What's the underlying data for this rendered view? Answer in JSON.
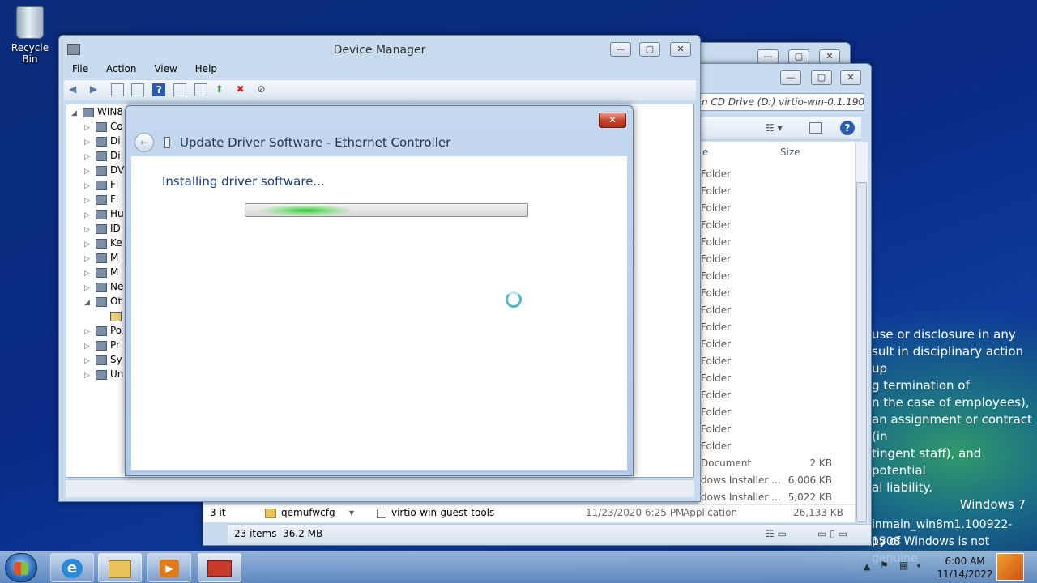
{
  "desktop": {
    "recycle_bin": "Recycle Bin",
    "watermark": [
      "use or disclosure in any",
      "sult in disciplinary action up",
      "g termination of",
      "n the case of employees),",
      "an assignment or contract (in",
      "tingent staff), and potential",
      "al liability."
    ],
    "os_name": "Windows 7",
    "build": "inmain_win8m1.100922-1508",
    "genuine": "py of Windows is not genuine"
  },
  "device_manager": {
    "title": "Device Manager",
    "menu": [
      "File",
      "Action",
      "View",
      "Help"
    ],
    "tree_root": "WIN8",
    "tree_items": [
      "Co",
      "Di",
      "Di",
      "DV",
      "Fl",
      "Fl",
      "Hu",
      "ID",
      "Ke",
      "M",
      "M",
      "Ne",
      "Ot",
      "",
      "Po",
      "Pr",
      "Sy",
      "Un"
    ]
  },
  "dialog": {
    "title": "Update Driver Software - Ethernet Controller",
    "status": "Installing driver software...",
    "progress": "indeterminate"
  },
  "explorer": {
    "address": "n CD Drive (D:) virtio-win-0.1.190",
    "col_name": "e",
    "col_size": "Size",
    "rows": [
      {
        "type": "Folder",
        "size": ""
      },
      {
        "type": "Folder",
        "size": ""
      },
      {
        "type": "Folder",
        "size": ""
      },
      {
        "type": "Folder",
        "size": ""
      },
      {
        "type": "Folder",
        "size": ""
      },
      {
        "type": "Folder",
        "size": ""
      },
      {
        "type": "Folder",
        "size": ""
      },
      {
        "type": "Folder",
        "size": ""
      },
      {
        "type": "Folder",
        "size": ""
      },
      {
        "type": "Folder",
        "size": ""
      },
      {
        "type": "Folder",
        "size": ""
      },
      {
        "type": "Folder",
        "size": ""
      },
      {
        "type": "Folder",
        "size": ""
      },
      {
        "type": "Folder",
        "size": ""
      },
      {
        "type": "Folder",
        "size": ""
      },
      {
        "type": "Folder",
        "size": ""
      },
      {
        "type": "Folder",
        "size": ""
      },
      {
        "type": "Document",
        "size": "2 KB"
      },
      {
        "type": "dows Installer ...",
        "size": "6,006 KB"
      },
      {
        "type": "dows Installer ...",
        "size": "5,022 KB"
      }
    ],
    "bottom_left": "qemufwcfg",
    "bottom_left_prefix": "3 it",
    "last_row": {
      "name": "virtio-win-guest-tools",
      "date": "11/23/2020 6:25 PM",
      "type": "Application",
      "size": "26,133 KB"
    },
    "status": "23 items  36.2 MB"
  },
  "taskbar": {
    "time": "6:00 AM",
    "date": "11/14/2022"
  }
}
